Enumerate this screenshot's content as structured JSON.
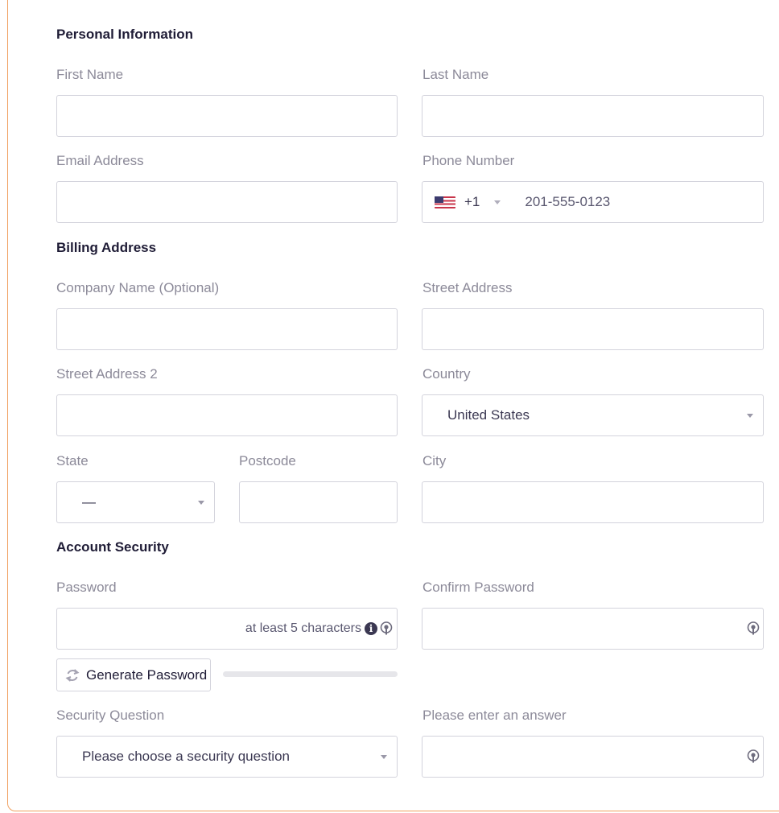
{
  "sections": {
    "personal": "Personal Information",
    "billing": "Billing Address",
    "security": "Account Security"
  },
  "fields": {
    "first_name": {
      "label": "First Name",
      "value": ""
    },
    "last_name": {
      "label": "Last Name",
      "value": ""
    },
    "email": {
      "label": "Email Address",
      "value": ""
    },
    "phone": {
      "label": "Phone Number",
      "dial_code": "+1",
      "country_flag": "us-flag-icon",
      "value": "201-555-0123"
    },
    "company": {
      "label": "Company Name (Optional)",
      "value": ""
    },
    "street": {
      "label": "Street Address",
      "value": ""
    },
    "street2": {
      "label": "Street Address 2",
      "value": ""
    },
    "country": {
      "label": "Country",
      "value": "United States"
    },
    "state": {
      "label": "State",
      "value": "—"
    },
    "postcode": {
      "label": "Postcode",
      "value": ""
    },
    "city": {
      "label": "City",
      "value": ""
    },
    "password": {
      "label": "Password",
      "value": "",
      "hint": "at least 5 characters",
      "strength": 0
    },
    "confirm_password": {
      "label": "Confirm Password",
      "value": ""
    },
    "security_question": {
      "label": "Security Question",
      "value": "Please choose a security question"
    },
    "security_answer": {
      "label": "Please enter an answer",
      "value": ""
    }
  },
  "buttons": {
    "generate_password": "Generate Password"
  },
  "colors": {
    "accent_border": "#f0a060",
    "label": "#8c8a99",
    "heading": "#1f1c36"
  }
}
